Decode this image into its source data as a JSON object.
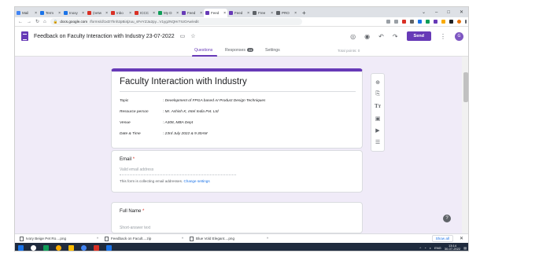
{
  "browser": {
    "tabs": [
      {
        "label": "Mail",
        "color": "#4285f4"
      },
      {
        "label": "Term",
        "color": "#1a73e8"
      },
      {
        "label": "Inoxy",
        "color": "#1a73e8"
      },
      {
        "label": "(netw",
        "color": "#d93025"
      },
      {
        "label": "Inbo",
        "color": "#d93025"
      },
      {
        "label": "ICCC",
        "color": "#d93025"
      },
      {
        "label": "My D",
        "color": "#0f9d58"
      },
      {
        "label": "Feed",
        "color": "#673ab7"
      },
      {
        "label": "Feed",
        "color": "#673ab7",
        "active": true
      },
      {
        "label": "Feed",
        "color": "#673ab7"
      },
      {
        "label": "Free",
        "color": "#5f6368"
      },
      {
        "label": "PRO",
        "color": "#5f6368"
      }
    ],
    "url_host": "docs.google.com",
    "url_path": "/forms/d/1xD7hnh2pBi4jzuu_sFeYZJa2py...V1ygzNQHr7IUOAw/edit"
  },
  "header": {
    "form_title": "Feedback on Faculty Interaction with Industry 23-07-2022",
    "send_label": "Send",
    "avatar_letter": "G"
  },
  "subtabs": {
    "questions": "Questions",
    "responses": "Responses",
    "responses_count": "24",
    "settings": "Settings",
    "total_points": "Total points: 0"
  },
  "title_card": {
    "title": "Faculty Interaction with Industry",
    "rows": [
      {
        "label": "Topic",
        "value": ": Development of FPGA based AI Product Design Techniques"
      },
      {
        "label": "Resource person",
        "value": ":  Mr. Ashish K, Intel India Pvt. Ltd"
      },
      {
        "label": "Venue",
        "value": ": A308, MBA Dept"
      },
      {
        "label": "Date & Time",
        "value": ": 23rd July 2022 & 9.30AM"
      }
    ]
  },
  "email_card": {
    "label": "Email",
    "required_mark": "*",
    "placeholder": "Valid email address",
    "collect_note": "This form is collecting email addresses.",
    "change_settings": "Change settings"
  },
  "name_card": {
    "label": "Full Name",
    "required_mark": "*",
    "placeholder": "Short-answer text"
  },
  "downloads": {
    "items": [
      "Ivory Beige Pet Ro....png",
      "Feedback on Facult....zip",
      "Blue Vold Elegant....png"
    ],
    "show_all": "Show all"
  },
  "taskbar": {
    "time": "13:14",
    "date": "30-07-2022",
    "lang": "ENG"
  },
  "colors": {
    "accent": "#673ab7",
    "background": "#f0ebf8"
  }
}
